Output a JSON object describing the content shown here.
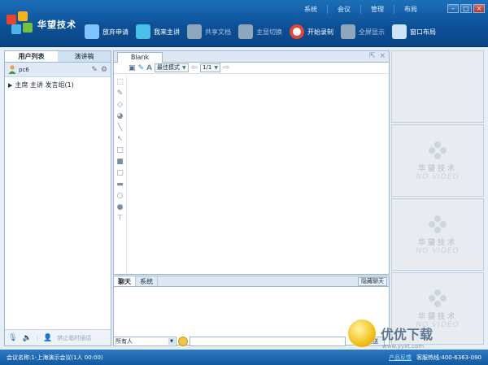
{
  "app": {
    "brand": "华望技术"
  },
  "topmenu": [
    "系统",
    "会议",
    "管理",
    "布局"
  ],
  "window_buttons": [
    "–",
    "□",
    "×"
  ],
  "toolbar": [
    {
      "label": "放弃申请",
      "icon": "mic-icon",
      "color": "#7fc3ff",
      "enabled": true
    },
    {
      "label": "我来主讲",
      "icon": "presenter-icon",
      "color": "#49c0e8",
      "enabled": true
    },
    {
      "label": "共享文档",
      "icon": "share-doc-icon",
      "color": "#8fa7bd",
      "enabled": false
    },
    {
      "label": "主显切换",
      "icon": "switch-display-icon",
      "color": "#8fa7bd",
      "enabled": false
    },
    {
      "label": "开始录制",
      "icon": "record-icon",
      "color": "#e2463a",
      "enabled": true
    },
    {
      "label": "全屏显示",
      "icon": "fullscreen-icon",
      "color": "#8fa7bd",
      "enabled": false
    },
    {
      "label": "窗口布局",
      "icon": "layout-icon",
      "color": "#cfe3f6",
      "enabled": true
    }
  ],
  "left_panel": {
    "tabs": [
      "用户列表",
      "演讲稿"
    ],
    "active_tab": "用户列表",
    "user": {
      "name": "pc6"
    },
    "group_line": "主席 主讲 发言组(1)",
    "footer_action": "禁止临时插话"
  },
  "whiteboard": {
    "tab": "Blank",
    "fit_mode": "最佳模式",
    "page": "1/1"
  },
  "chat": {
    "tabs": [
      "聊天",
      "系统"
    ],
    "active_tab": "聊天",
    "hide_label": "隐藏聊天",
    "recipient": "所有人",
    "send_label": "发送"
  },
  "videos": [
    {
      "brand": "华望技术",
      "status": "NO VIDEO"
    },
    {
      "brand": "华望技术",
      "status": "NO VIDEO"
    },
    {
      "brand": "华望技术",
      "status": "NO VIDEO"
    }
  ],
  "status_bar": {
    "meeting": "会议名称:1-上海演示会议(1人 00:00)",
    "feedback": "产品反馈",
    "hotline": "客服热线:400-6363-090"
  },
  "watermark": {
    "text": "优优下载",
    "url": "www.yyxt.com"
  }
}
